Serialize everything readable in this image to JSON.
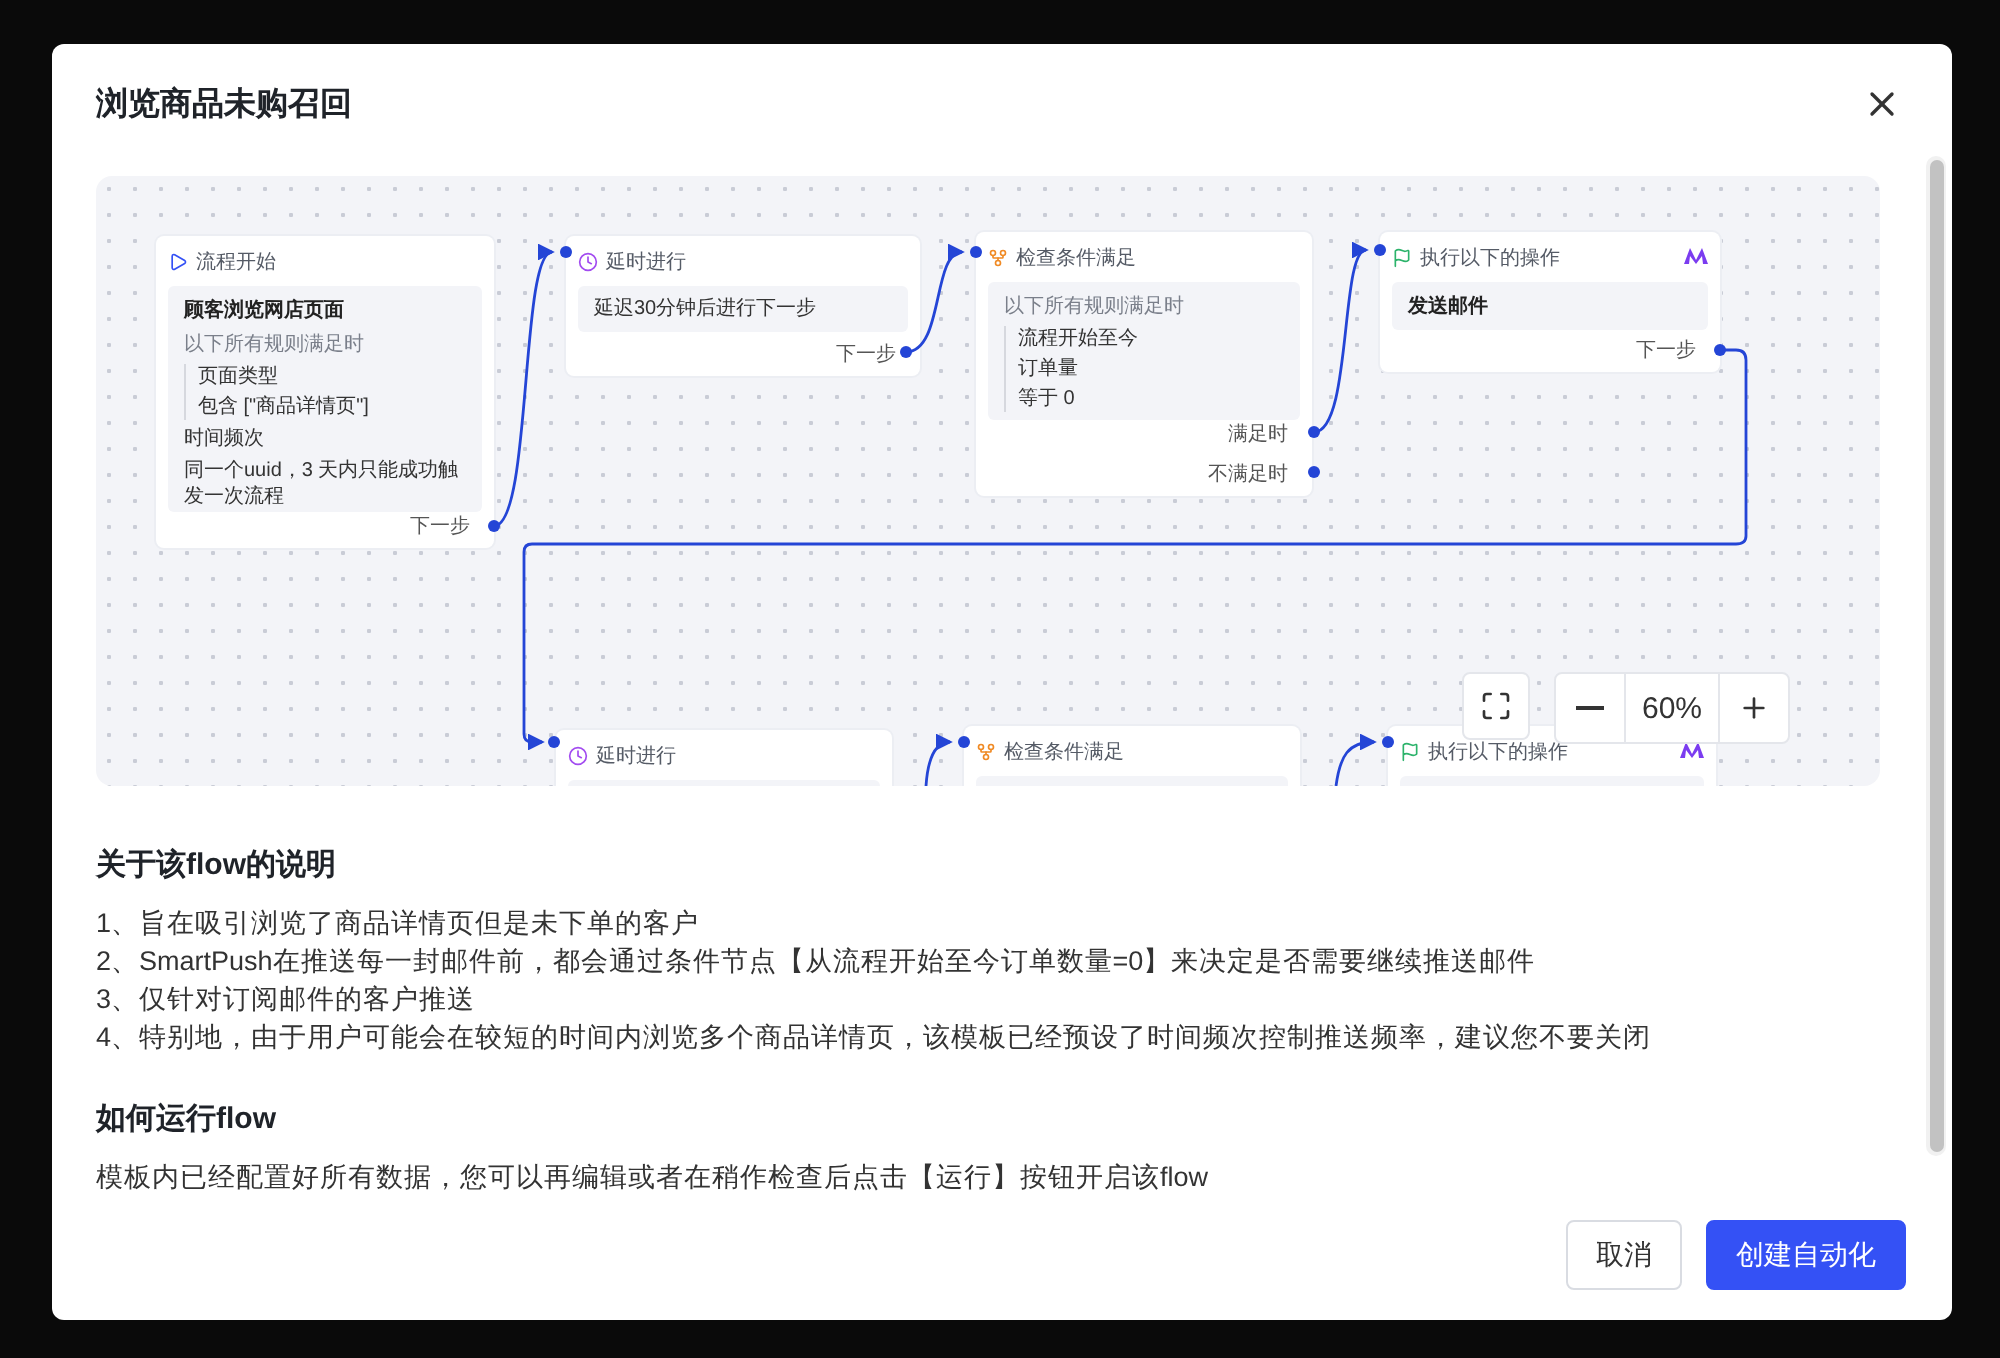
{
  "dialog": {
    "title": "浏览商品未购召回"
  },
  "flow": {
    "nodes": [
      {
        "kind": "start",
        "title": "流程开始",
        "body": {
          "heading": "顾客浏览网店页面",
          "note": "以下所有规则满足时",
          "rules": [
            "页面类型",
            "包含 [\"商品详情页\"]"
          ],
          "lines": [
            "时间频次",
            "同一个uuid，3 天内只能成功触发一次流程"
          ]
        },
        "ports": [
          "下一步"
        ]
      },
      {
        "kind": "delay",
        "title": "延时进行",
        "body": {
          "lines": [
            "延迟30分钟后进行下一步"
          ]
        },
        "ports": [
          "下一步"
        ]
      },
      {
        "kind": "condition",
        "title": "检查条件满足",
        "body": {
          "note": "以下所有规则满足时",
          "rules": [
            "流程开始至今",
            "订单量",
            "等于  0"
          ]
        },
        "ports": [
          "满足时",
          "不满足时"
        ]
      },
      {
        "kind": "action",
        "title": "执行以下的操作",
        "body": {
          "heading": "发送邮件"
        },
        "ports": [
          "下一步"
        ]
      },
      {
        "kind": "delay",
        "title": "延时进行"
      },
      {
        "kind": "condition",
        "title": "检查条件满足"
      },
      {
        "kind": "action",
        "title": "执行以下的操作"
      }
    ],
    "zoom": "60%"
  },
  "sections": [
    {
      "heading": "关于该flow的说明",
      "lines": [
        "1、旨在吸引浏览了商品详情页但是未下单的客户",
        "2、SmartPush在推送每一封邮件前，都会通过条件节点【从流程开始至今订单数量=0】来决定是否需要继续推送邮件",
        "3、仅针对订阅邮件的客户推送",
        "4、特别地，由于用户可能会在较短的时间内浏览多个商品详情页，该模板已经预设了时间频次控制推送频率，建议您不要关闭"
      ]
    },
    {
      "heading": "如何运行flow",
      "lines": [
        "模板内已经配置好所有数据，您可以再编辑或者在稍作检查后点击【运行】按钮开启该flow"
      ]
    }
  ],
  "buttons": [
    {
      "label": "取消",
      "kind": "secondary"
    },
    {
      "label": "创建自动化",
      "kind": "primary"
    }
  ]
}
